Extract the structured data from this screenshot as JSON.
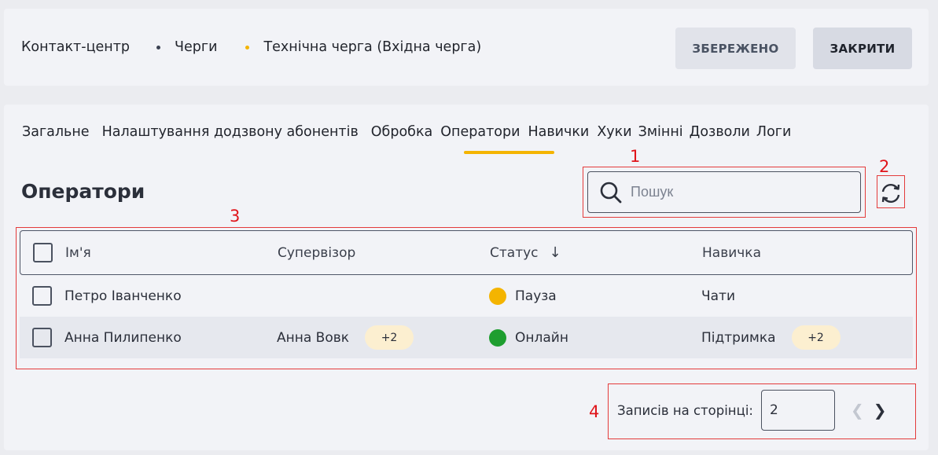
{
  "header": {
    "breadcrumb": [
      "Контакт-центр",
      "Черги",
      "Технічна черга (Вхідна черга)"
    ],
    "saved_label": "ЗБЕРЕЖЕНО",
    "close_label": "ЗАКРИТИ"
  },
  "tabs": [
    "Загальне",
    "Налаштування додзвону абонентів",
    "Обробка",
    "Оператори",
    "Навички",
    "Хуки",
    "Змінні",
    "Дозволи",
    "Логи"
  ],
  "active_tab": "Оператори",
  "section_title": "Оператори",
  "search": {
    "placeholder": "Пошук",
    "value": ""
  },
  "table": {
    "headers": [
      "Ім'я",
      "Супервізор",
      "Статус",
      "Навичка"
    ],
    "sort_icon": "arrow-down-icon",
    "rows": [
      {
        "name": "Петро Іванченко",
        "supervisor": "",
        "supervisor_extra": "",
        "status": "Пауза",
        "status_color": "#f4b400",
        "skill": "Чати",
        "skill_extra": ""
      },
      {
        "name": "Анна Пилипенко",
        "supervisor": "Анна Вовк",
        "supervisor_extra": "+2",
        "status": "Онлайн",
        "status_color": "#1e9e2f",
        "skill": "Підтримка",
        "skill_extra": "+2"
      }
    ]
  },
  "pager": {
    "label": "Записів на сторінці:",
    "value": "2"
  },
  "annotations": [
    "1",
    "2",
    "3",
    "4"
  ],
  "colors": {
    "accent": "#f4b400",
    "annotation": "#e0141a"
  }
}
